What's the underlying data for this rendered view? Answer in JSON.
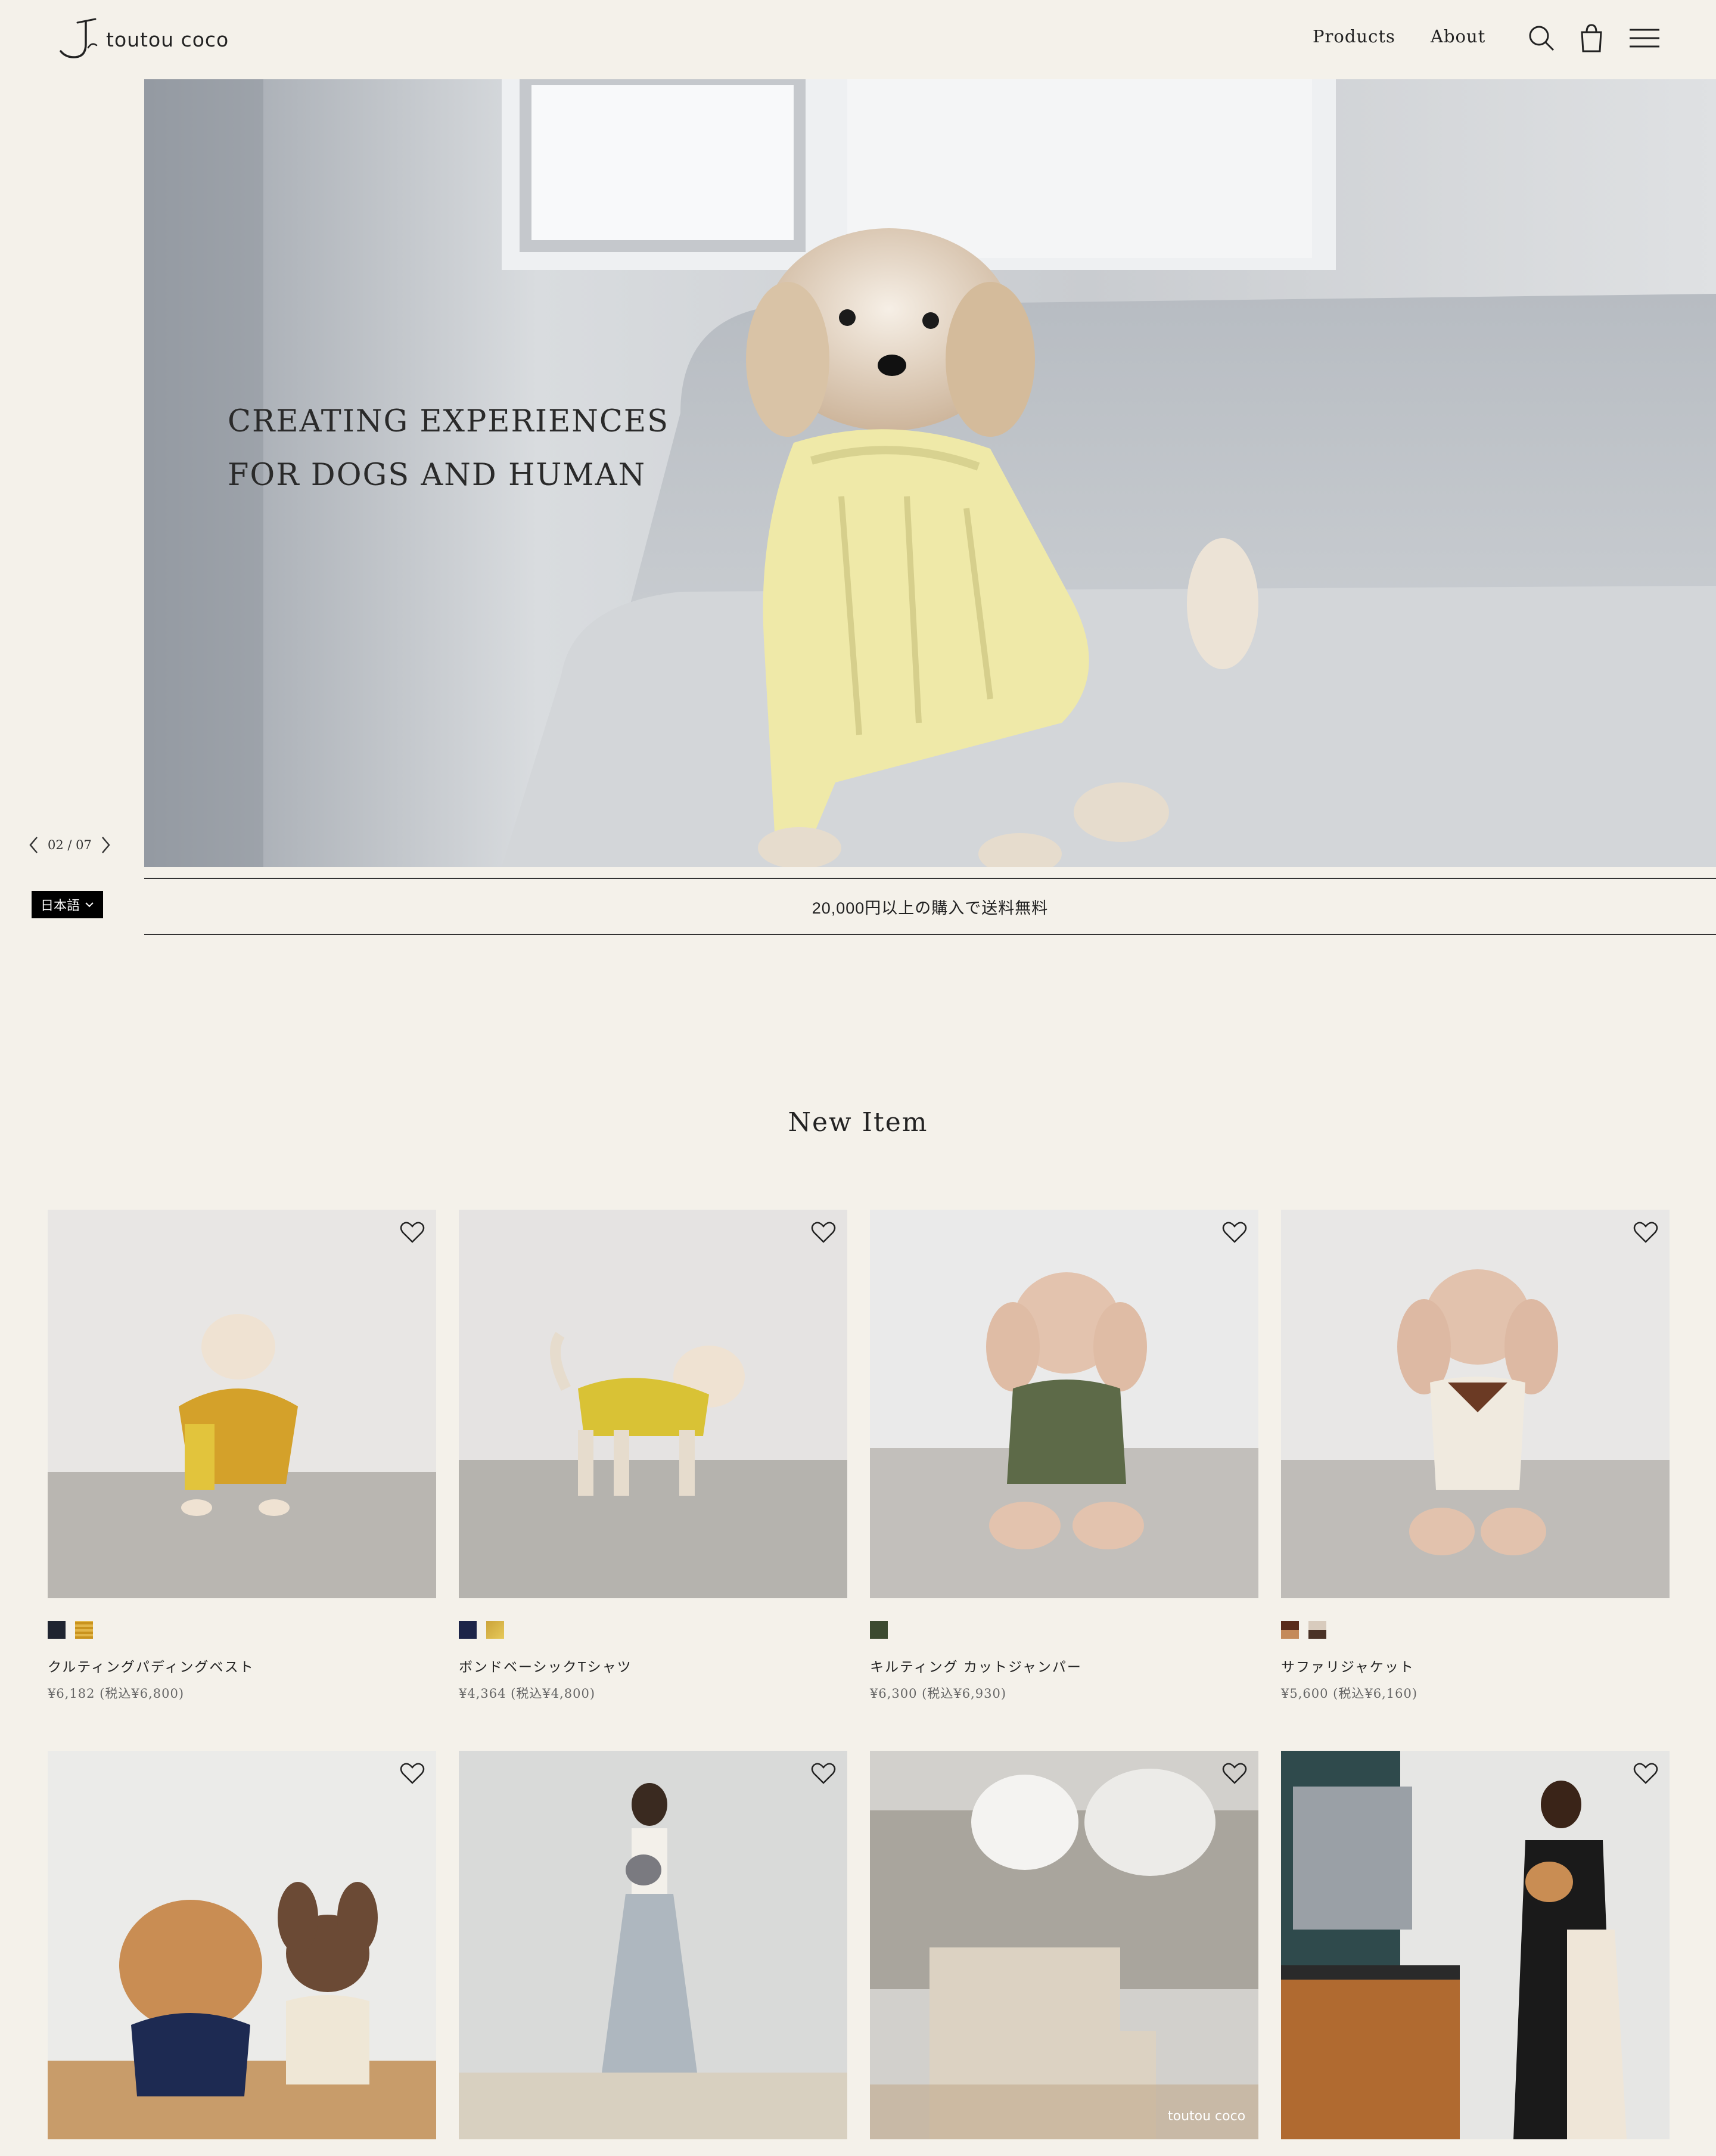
{
  "header": {
    "logo_text": "toutou coco",
    "nav": [
      "Products",
      "About"
    ]
  },
  "hero": {
    "line1": "CREATING EXPERIENCES",
    "line2": "FOR DOGS AND HUMAN",
    "slide_counter": "02 / 07"
  },
  "language": {
    "selected": "日本語"
  },
  "banner": {
    "text": "20,000円以上の購入で送料無料"
  },
  "section": {
    "title": "New Item"
  },
  "products": [
    {
      "name": "クルティングパディングベスト",
      "price": "¥6,182 (税込¥6,800)",
      "swatches": [
        "#1f2430",
        "#c9931e"
      ]
    },
    {
      "name": "ボンドベーシックTシャツ",
      "price": "¥4,364 (税込¥4,800)",
      "swatches": [
        "#1c2448",
        "#cba33a"
      ]
    },
    {
      "name": "キルティング カットジャンパー",
      "price": "¥6,300 (税込¥6,930)",
      "swatches": [
        "#3c4a30"
      ]
    },
    {
      "name": "サファリジャケット",
      "price": "¥5,600 (税込¥6,160)",
      "swatches": [
        "#5a2c1a",
        "#d8cbbd"
      ]
    }
  ],
  "watermark": {
    "text": "toutou coco"
  }
}
